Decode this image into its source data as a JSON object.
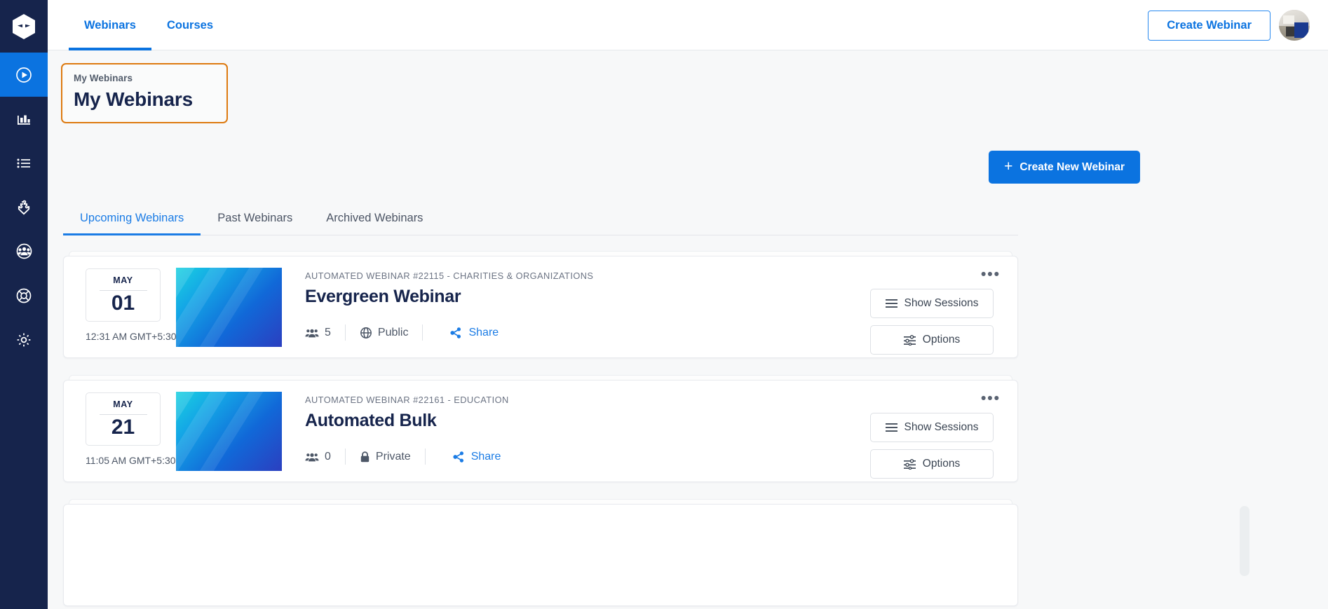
{
  "brand": {
    "logo_icon": "hexagon-mask-logo",
    "accent_blue": "#0b73e0",
    "sidebar_bg": "#16244c",
    "highlight_orange": "#dd7a10"
  },
  "sidebar": {
    "items": [
      {
        "icon": "play-circle-icon",
        "name": "webinars",
        "active": true
      },
      {
        "icon": "bar-chart-icon",
        "name": "analytics",
        "active": false
      },
      {
        "icon": "list-icon",
        "name": "registrants",
        "active": false
      },
      {
        "icon": "puzzle-icon",
        "name": "integrations",
        "active": false
      },
      {
        "icon": "users-group-icon",
        "name": "contacts",
        "active": false
      },
      {
        "icon": "lifebuoy-icon",
        "name": "support",
        "active": false
      },
      {
        "icon": "gear-icon",
        "name": "settings",
        "active": false
      }
    ]
  },
  "topbar": {
    "nav": [
      {
        "label": "Webinars",
        "active": true
      },
      {
        "label": "Courses",
        "active": false
      }
    ],
    "create_webinar_label": "Create Webinar",
    "avatar_icon": "user-avatar-photo"
  },
  "page": {
    "eyebrow": "My Webinars",
    "title": "My Webinars",
    "create_new_label": "Create New Webinar",
    "create_new_icon": "plus-icon"
  },
  "tabs": [
    {
      "label": "Upcoming Webinars",
      "active": true
    },
    {
      "label": "Past Webinars",
      "active": false
    },
    {
      "label": "Archived Webinars",
      "active": false
    }
  ],
  "webinars": [
    {
      "month": "MAY",
      "day": "01",
      "time": "12:31 AM GMT+5:30",
      "eyebrow": "AUTOMATED WEBINAR #22115 - CHARITIES & ORGANIZATIONS",
      "title": "Evergreen Webinar",
      "attendees": "5",
      "attendees_icon": "users-group-icon",
      "privacy": "Public",
      "privacy_icon": "globe-icon",
      "share_label": "Share",
      "share_icon": "share-nodes-icon",
      "show_sessions_label": "Show Sessions",
      "show_sessions_icon": "list-lines-icon",
      "options_label": "Options",
      "options_icon": "sliders-icon",
      "menu_icon": "ellipsis-icon",
      "menu_label": "•••"
    },
    {
      "month": "MAY",
      "day": "21",
      "time": "11:05 AM GMT+5:30",
      "eyebrow": "AUTOMATED WEBINAR #22161 - EDUCATION",
      "title": "Automated Bulk",
      "attendees": "0",
      "attendees_icon": "users-group-icon",
      "privacy": "Private",
      "privacy_icon": "lock-icon",
      "share_label": "Share",
      "share_icon": "share-nodes-icon",
      "show_sessions_label": "Show Sessions",
      "show_sessions_icon": "list-lines-icon",
      "options_label": "Options",
      "options_icon": "sliders-icon",
      "menu_icon": "ellipsis-icon",
      "menu_label": "•••"
    }
  ]
}
